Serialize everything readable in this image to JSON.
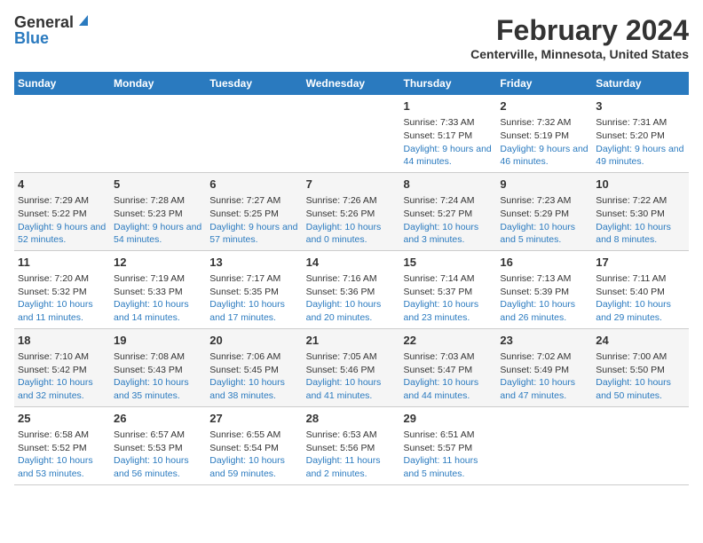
{
  "logo": {
    "general": "General",
    "blue": "Blue"
  },
  "header": {
    "title": "February 2024",
    "subtitle": "Centerville, Minnesota, United States"
  },
  "days_of_week": [
    "Sunday",
    "Monday",
    "Tuesday",
    "Wednesday",
    "Thursday",
    "Friday",
    "Saturday"
  ],
  "weeks": [
    [
      {
        "day": "",
        "sunrise": "",
        "sunset": "",
        "daylight": ""
      },
      {
        "day": "",
        "sunrise": "",
        "sunset": "",
        "daylight": ""
      },
      {
        "day": "",
        "sunrise": "",
        "sunset": "",
        "daylight": ""
      },
      {
        "day": "",
        "sunrise": "",
        "sunset": "",
        "daylight": ""
      },
      {
        "day": "1",
        "sunrise": "Sunrise: 7:33 AM",
        "sunset": "Sunset: 5:17 PM",
        "daylight": "Daylight: 9 hours and 44 minutes."
      },
      {
        "day": "2",
        "sunrise": "Sunrise: 7:32 AM",
        "sunset": "Sunset: 5:19 PM",
        "daylight": "Daylight: 9 hours and 46 minutes."
      },
      {
        "day": "3",
        "sunrise": "Sunrise: 7:31 AM",
        "sunset": "Sunset: 5:20 PM",
        "daylight": "Daylight: 9 hours and 49 minutes."
      }
    ],
    [
      {
        "day": "4",
        "sunrise": "Sunrise: 7:29 AM",
        "sunset": "Sunset: 5:22 PM",
        "daylight": "Daylight: 9 hours and 52 minutes."
      },
      {
        "day": "5",
        "sunrise": "Sunrise: 7:28 AM",
        "sunset": "Sunset: 5:23 PM",
        "daylight": "Daylight: 9 hours and 54 minutes."
      },
      {
        "day": "6",
        "sunrise": "Sunrise: 7:27 AM",
        "sunset": "Sunset: 5:25 PM",
        "daylight": "Daylight: 9 hours and 57 minutes."
      },
      {
        "day": "7",
        "sunrise": "Sunrise: 7:26 AM",
        "sunset": "Sunset: 5:26 PM",
        "daylight": "Daylight: 10 hours and 0 minutes."
      },
      {
        "day": "8",
        "sunrise": "Sunrise: 7:24 AM",
        "sunset": "Sunset: 5:27 PM",
        "daylight": "Daylight: 10 hours and 3 minutes."
      },
      {
        "day": "9",
        "sunrise": "Sunrise: 7:23 AM",
        "sunset": "Sunset: 5:29 PM",
        "daylight": "Daylight: 10 hours and 5 minutes."
      },
      {
        "day": "10",
        "sunrise": "Sunrise: 7:22 AM",
        "sunset": "Sunset: 5:30 PM",
        "daylight": "Daylight: 10 hours and 8 minutes."
      }
    ],
    [
      {
        "day": "11",
        "sunrise": "Sunrise: 7:20 AM",
        "sunset": "Sunset: 5:32 PM",
        "daylight": "Daylight: 10 hours and 11 minutes."
      },
      {
        "day": "12",
        "sunrise": "Sunrise: 7:19 AM",
        "sunset": "Sunset: 5:33 PM",
        "daylight": "Daylight: 10 hours and 14 minutes."
      },
      {
        "day": "13",
        "sunrise": "Sunrise: 7:17 AM",
        "sunset": "Sunset: 5:35 PM",
        "daylight": "Daylight: 10 hours and 17 minutes."
      },
      {
        "day": "14",
        "sunrise": "Sunrise: 7:16 AM",
        "sunset": "Sunset: 5:36 PM",
        "daylight": "Daylight: 10 hours and 20 minutes."
      },
      {
        "day": "15",
        "sunrise": "Sunrise: 7:14 AM",
        "sunset": "Sunset: 5:37 PM",
        "daylight": "Daylight: 10 hours and 23 minutes."
      },
      {
        "day": "16",
        "sunrise": "Sunrise: 7:13 AM",
        "sunset": "Sunset: 5:39 PM",
        "daylight": "Daylight: 10 hours and 26 minutes."
      },
      {
        "day": "17",
        "sunrise": "Sunrise: 7:11 AM",
        "sunset": "Sunset: 5:40 PM",
        "daylight": "Daylight: 10 hours and 29 minutes."
      }
    ],
    [
      {
        "day": "18",
        "sunrise": "Sunrise: 7:10 AM",
        "sunset": "Sunset: 5:42 PM",
        "daylight": "Daylight: 10 hours and 32 minutes."
      },
      {
        "day": "19",
        "sunrise": "Sunrise: 7:08 AM",
        "sunset": "Sunset: 5:43 PM",
        "daylight": "Daylight: 10 hours and 35 minutes."
      },
      {
        "day": "20",
        "sunrise": "Sunrise: 7:06 AM",
        "sunset": "Sunset: 5:45 PM",
        "daylight": "Daylight: 10 hours and 38 minutes."
      },
      {
        "day": "21",
        "sunrise": "Sunrise: 7:05 AM",
        "sunset": "Sunset: 5:46 PM",
        "daylight": "Daylight: 10 hours and 41 minutes."
      },
      {
        "day": "22",
        "sunrise": "Sunrise: 7:03 AM",
        "sunset": "Sunset: 5:47 PM",
        "daylight": "Daylight: 10 hours and 44 minutes."
      },
      {
        "day": "23",
        "sunrise": "Sunrise: 7:02 AM",
        "sunset": "Sunset: 5:49 PM",
        "daylight": "Daylight: 10 hours and 47 minutes."
      },
      {
        "day": "24",
        "sunrise": "Sunrise: 7:00 AM",
        "sunset": "Sunset: 5:50 PM",
        "daylight": "Daylight: 10 hours and 50 minutes."
      }
    ],
    [
      {
        "day": "25",
        "sunrise": "Sunrise: 6:58 AM",
        "sunset": "Sunset: 5:52 PM",
        "daylight": "Daylight: 10 hours and 53 minutes."
      },
      {
        "day": "26",
        "sunrise": "Sunrise: 6:57 AM",
        "sunset": "Sunset: 5:53 PM",
        "daylight": "Daylight: 10 hours and 56 minutes."
      },
      {
        "day": "27",
        "sunrise": "Sunrise: 6:55 AM",
        "sunset": "Sunset: 5:54 PM",
        "daylight": "Daylight: 10 hours and 59 minutes."
      },
      {
        "day": "28",
        "sunrise": "Sunrise: 6:53 AM",
        "sunset": "Sunset: 5:56 PM",
        "daylight": "Daylight: 11 hours and 2 minutes."
      },
      {
        "day": "29",
        "sunrise": "Sunrise: 6:51 AM",
        "sunset": "Sunset: 5:57 PM",
        "daylight": "Daylight: 11 hours and 5 minutes."
      },
      {
        "day": "",
        "sunrise": "",
        "sunset": "",
        "daylight": ""
      },
      {
        "day": "",
        "sunrise": "",
        "sunset": "",
        "daylight": ""
      }
    ]
  ]
}
